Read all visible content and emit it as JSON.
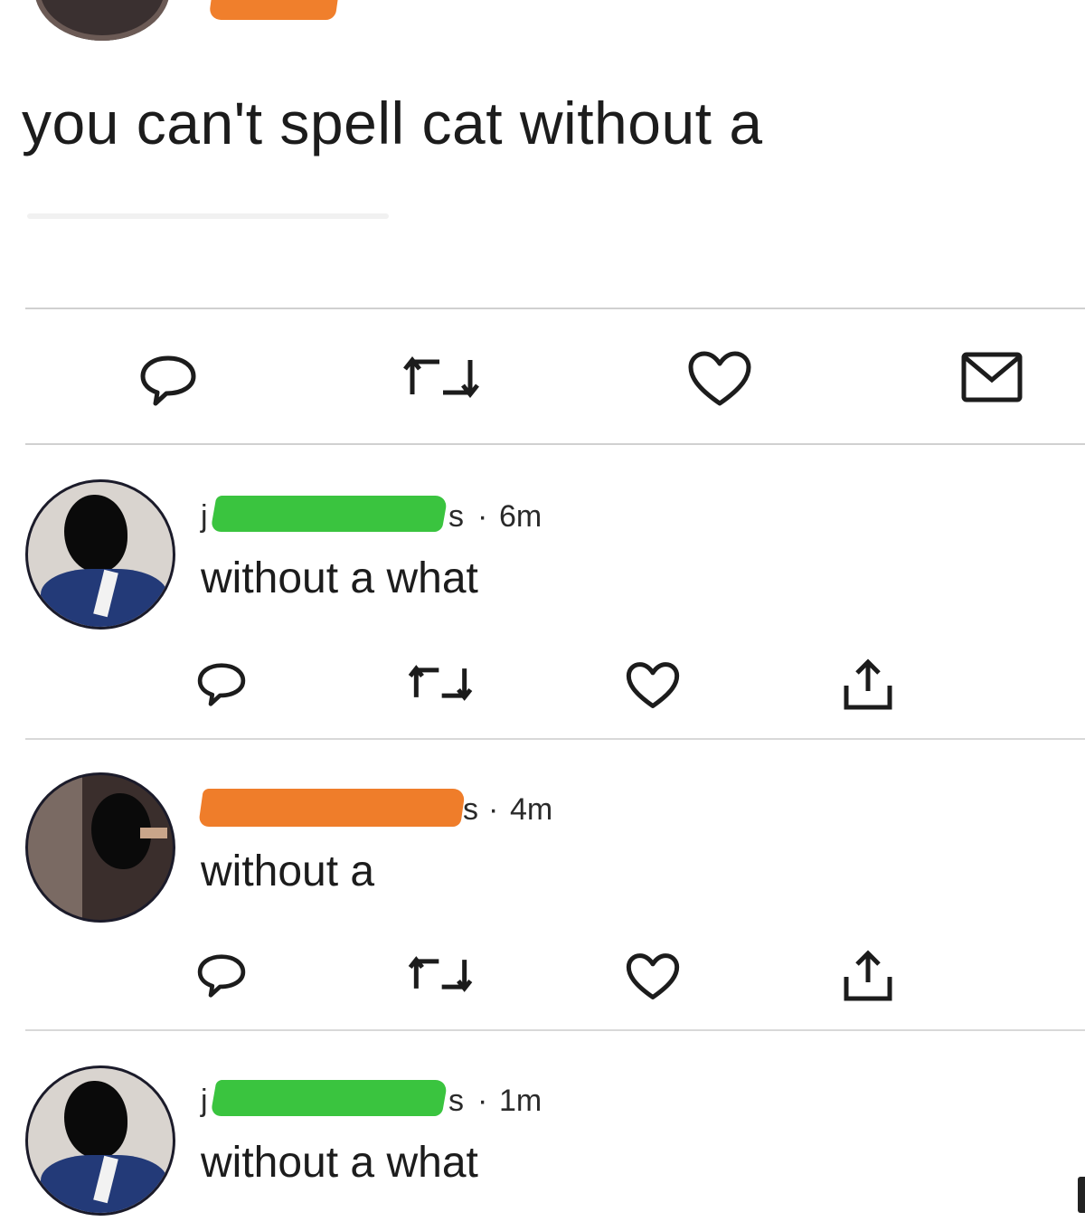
{
  "tweet": {
    "text": "you can't spell cat without a",
    "actions": [
      {
        "name": "reply-icon"
      },
      {
        "name": "retweet-icon"
      },
      {
        "name": "like-icon"
      },
      {
        "name": "message-icon"
      }
    ]
  },
  "replies": [
    {
      "handle_prefix": "j",
      "handle_suffix": "s",
      "separator": "·",
      "time": "6m",
      "text": "without a what",
      "redact_color": "#3ac43f"
    },
    {
      "handle_prefix": "",
      "handle_suffix": "s",
      "separator": "·",
      "time": "4m",
      "text": "without a",
      "redact_color": "#ef7d2a"
    },
    {
      "handle_prefix": "j",
      "handle_suffix": "s",
      "separator": "·",
      "time": "1m",
      "text": "without a what",
      "redact_color": "#3ac43f"
    }
  ],
  "reply_actions": [
    "reply-icon",
    "retweet-icon",
    "like-icon",
    "share-icon"
  ]
}
